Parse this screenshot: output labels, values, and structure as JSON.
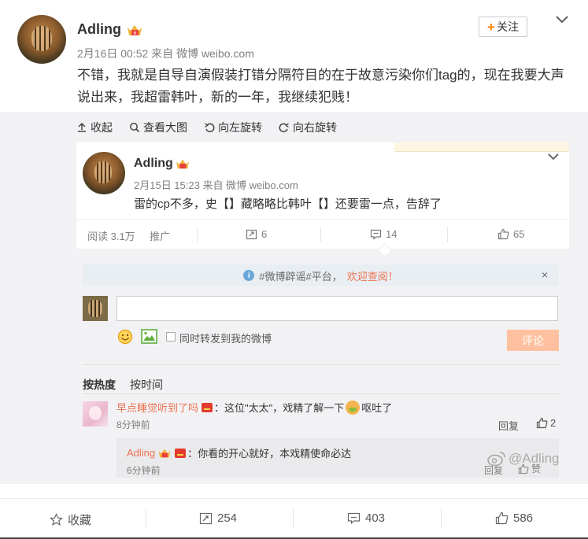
{
  "post": {
    "author": "Adling",
    "meta": "2月16日 00:52 来自 微博 weibo.com",
    "follow_label": "关注",
    "text": "不错，我就是自导自演假装打错分隔符目的在于故意污染你们tag的，现在我要大声说出来，我超雷韩叶，新的一年，我继续犯贱！"
  },
  "toolbar": {
    "collapse": "收起",
    "view_large": "查看大图",
    "rotate_left": "向左旋转",
    "rotate_right": "向右旋转"
  },
  "repost": {
    "author": "Adling",
    "meta": "2月15日 15:23 来自 微博 weibo.com",
    "text": "雷的cp不多，史【】藏略略比韩叶【】还要雷一点，告辞了",
    "reads": "阅读 3.1万",
    "promote": "推广",
    "reposts": "6",
    "comments": "14",
    "likes": "65"
  },
  "comment_box": {
    "notice_text": "#微博辟谣#平台，",
    "notice_link": "欢迎查阅！",
    "notice_close": "×",
    "input_placeholder": "",
    "repost_label": "同时转发到我的微博",
    "submit_label": "评论"
  },
  "sort": {
    "hot": "按热度",
    "time": "按时间"
  },
  "comments": [
    {
      "user": "早点睡觉听到了吗",
      "text_before": "：这位\"太太\"，戏精了解一下",
      "text_after": "呕吐了",
      "time": "8分钟前",
      "reply_label": "回复",
      "likes": "2"
    }
  ],
  "sub_comment": {
    "user": "Adling",
    "text": "：你看的开心就好，本戏精使命必达",
    "time": "6分钟前",
    "reply_label": "回复",
    "like_label": "赞"
  },
  "watermark": "@Adling",
  "bottom": {
    "favorite": "收藏",
    "reposts": "254",
    "comments": "403",
    "likes": "586"
  },
  "colors": {
    "accent_orange": "#ff8200",
    "link_orange": "#eb7350",
    "submit_disabled": "#ffc09f"
  }
}
